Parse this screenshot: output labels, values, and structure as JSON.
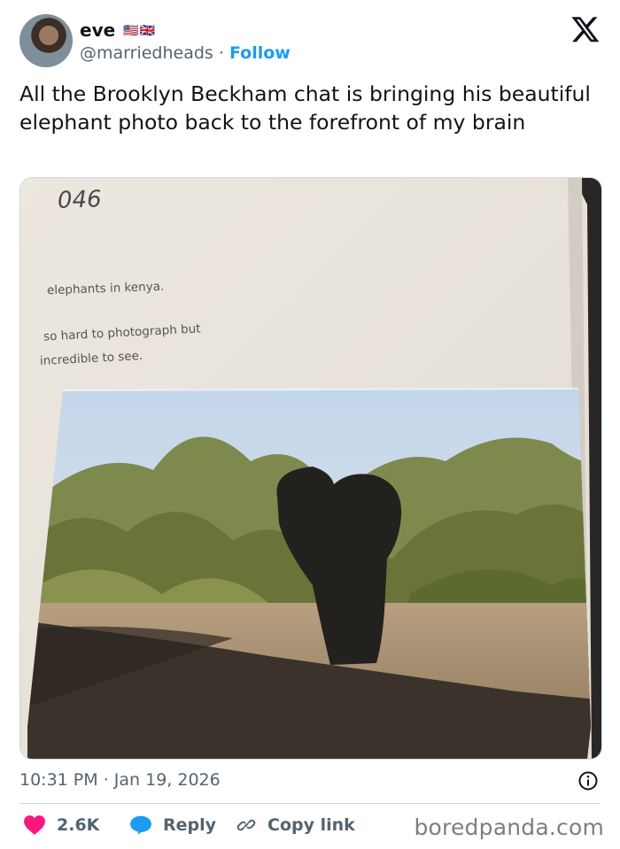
{
  "author": {
    "display_name": "eve",
    "name_emoji": "🇺🇸🇬🇧",
    "handle": "@marriedheads",
    "separator": "·",
    "follow_label": "Follow"
  },
  "tweet": {
    "text": "All the Brooklyn Beckham chat is bringing his beautiful elephant photo back to the forefront of my brain"
  },
  "media": {
    "page_number": "046",
    "caption_line1": "elephants in kenya.",
    "caption_line2": "so hard to photograph but",
    "caption_line3": "incredible to see."
  },
  "meta": {
    "time": "10:31 PM",
    "dot": "·",
    "date": "Jan 19, 2026"
  },
  "actions": {
    "likes": "2.6K",
    "reply": "Reply",
    "copy_link": "Copy link"
  },
  "watermark": "boredpanda.com",
  "colors": {
    "accent": "#1d9bf0",
    "like": "#f91880",
    "text": "#0f1419",
    "muted": "#536471"
  },
  "icons": [
    "x-logo-icon",
    "info-icon",
    "heart-icon",
    "speech-bubble-icon",
    "link-icon"
  ]
}
